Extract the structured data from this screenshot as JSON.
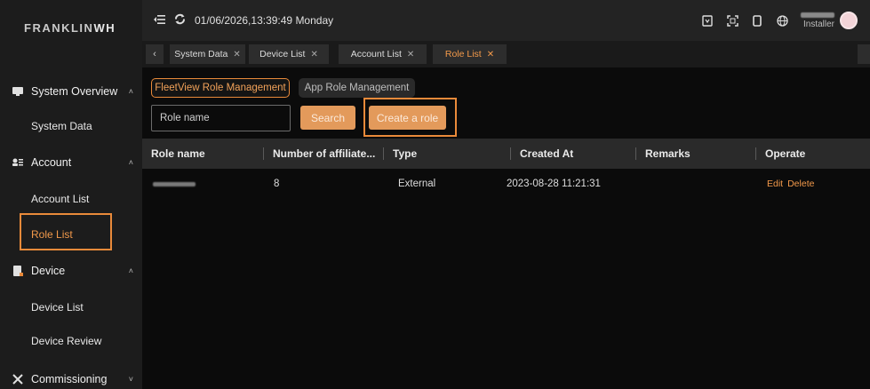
{
  "logo": {
    "part1": "FRANKLIN",
    "part2": "WH"
  },
  "header": {
    "datetime": "01/06/2026,13:39:49 Monday",
    "user_role": "Installer"
  },
  "sidebar": {
    "groups": [
      {
        "label": "System Overview",
        "icon": "monitor-icon",
        "items": [
          {
            "label": "System Data"
          }
        ]
      },
      {
        "label": "Account",
        "icon": "account-list-icon",
        "items": [
          {
            "label": "Account List"
          },
          {
            "label": "Role List",
            "selected": true
          }
        ]
      },
      {
        "label": "Device",
        "icon": "device-icon",
        "items": [
          {
            "label": "Device List"
          },
          {
            "label": "Device Review"
          }
        ]
      },
      {
        "label": "Commissioning",
        "icon": "tools-icon",
        "items": []
      }
    ]
  },
  "tabs": [
    {
      "label": "System Data"
    },
    {
      "label": "Device List"
    },
    {
      "label": "Account List"
    },
    {
      "label": "Role List",
      "active": true
    }
  ],
  "main": {
    "tabs": [
      {
        "label": "FleetView Role Management",
        "active": true
      },
      {
        "label": "App Role Management"
      }
    ],
    "search_placeholder": "Role name",
    "search_button": "Search",
    "create_button": "Create a role"
  },
  "table": {
    "columns": [
      "Role name",
      "Number of affiliate...",
      "Type",
      "Created At",
      "Remarks",
      "Operate"
    ],
    "rows": [
      {
        "role_name": "",
        "affiliates": "8",
        "type": "External",
        "created_at": "2023-08-28 11:21:31",
        "remarks": "",
        "edit": "Edit",
        "delete": "Delete"
      }
    ]
  },
  "colors": {
    "accent": "#f2994a",
    "sidebar_bg": "#1c1c1c",
    "page_bg": "#0b0b0b",
    "button": "#e39a5b"
  }
}
